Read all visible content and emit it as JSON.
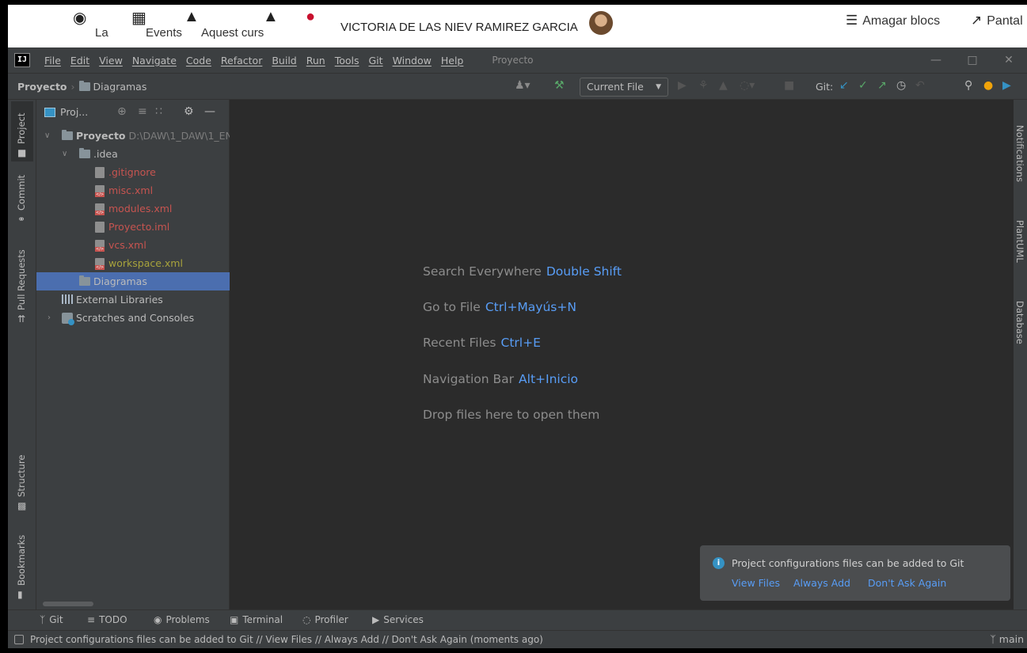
{
  "moodle": {
    "items": [
      {
        "icon": "dashboard-icon",
        "glyph": "⛭",
        "label": "La"
      },
      {
        "icon": "calendar-icon",
        "glyph": "▦",
        "label": "Events"
      },
      {
        "icon": "sitemap-icon",
        "glyph": "⁂",
        "label": "Aquest curs"
      },
      {
        "icon": "bell-icon",
        "glyph": "🔔",
        "label": ""
      },
      {
        "icon": "chat-icon",
        "glyph": "●",
        "label": ""
      }
    ],
    "user_name": "VICTORIA DE LAS NIEV RAMIREZ GARCIA",
    "collapse_blocks": "Amagar blocs",
    "fullscreen": "Pantal"
  },
  "menubar": {
    "app_logo": "IJ",
    "items": [
      "File",
      "Edit",
      "View",
      "Navigate",
      "Code",
      "Refactor",
      "Build",
      "Run",
      "Tools",
      "Git",
      "Window",
      "Help"
    ],
    "project_title": "Proyecto"
  },
  "navbar": {
    "breadcrumb_root": "Proyecto",
    "breadcrumb_child": "Diagramas",
    "run_config": "Current File",
    "git_label": "Git:"
  },
  "left_strip": {
    "tabs": [
      "Project",
      "Commit",
      "Pull Requests",
      "Structure",
      "Bookmarks"
    ]
  },
  "project_panel": {
    "title": "Proj...",
    "tree": {
      "root_name": "Proyecto",
      "root_path": "D:\\DAW\\1_DAW\\1_EN",
      "idea": ".idea",
      "files": [
        ".gitignore",
        "misc.xml",
        "modules.xml",
        "Proyecto.iml",
        "vcs.xml",
        "workspace.xml"
      ],
      "diagramas": "Diagramas",
      "external_libraries": "External Libraries",
      "scratches": "Scratches and Consoles"
    }
  },
  "editor": {
    "hints": [
      {
        "text": "Search Everywhere",
        "key": "Double Shift"
      },
      {
        "text": "Go to File",
        "key": "Ctrl+Mayús+N"
      },
      {
        "text": "Recent Files",
        "key": "Ctrl+E"
      },
      {
        "text": "Navigation Bar",
        "key": "Alt+Inicio"
      },
      {
        "text": "Drop files here to open them",
        "key": ""
      }
    ]
  },
  "right_strip": {
    "tabs": [
      "Notifications",
      "PlantUML",
      "Database"
    ]
  },
  "notification": {
    "message": "Project configurations files can be added to Git",
    "actions": [
      "View Files",
      "Always Add",
      "Don't Ask Again"
    ]
  },
  "bottom_tools": [
    "Git",
    "TODO",
    "Problems",
    "Terminal",
    "Profiler",
    "Services"
  ],
  "status": {
    "text": "Project configurations files can be added to Git // View Files // Always Add // Don't Ask Again (moments ago)",
    "branch": "main"
  },
  "colors": {
    "selection": "#4b6eaf",
    "link": "#589df6",
    "modified_red": "#c75450",
    "ignored_yellow": "#a8a33c",
    "vcs_green": "#59a869"
  }
}
